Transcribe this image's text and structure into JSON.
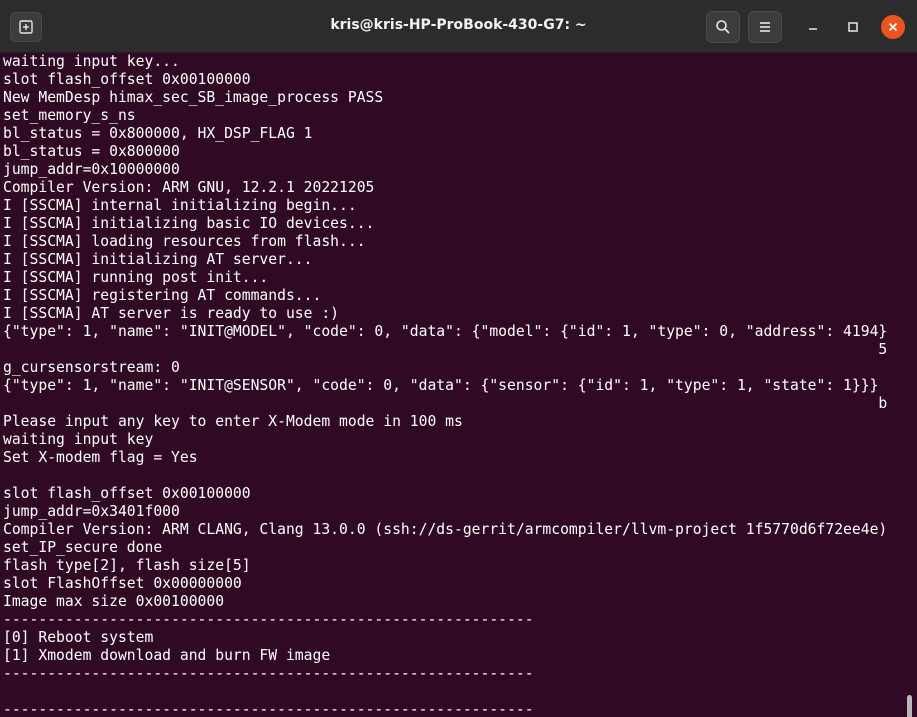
{
  "window": {
    "title": "kris@kris-HP-ProBook-430-G7: ~",
    "new_tab_icon": "new-tab-icon",
    "search_icon": "search-icon",
    "menu_icon": "hamburger-menu-icon",
    "minimize_icon": "minimize-icon",
    "maximize_icon": "maximize-icon",
    "close_icon": "close-icon",
    "close_color": "#e95420",
    "background": "#300a24"
  },
  "terminal": {
    "lines": [
      "waiting input key...",
      "slot flash_offset 0x00100000",
      "New MemDesp himax_sec_SB_image_process PASS",
      "set_memory_s_ns",
      "bl_status = 0x800000, HX_DSP_FLAG 1",
      "bl_status = 0x800000",
      "jump_addr=0x10000000",
      "Compiler Version: ARM GNU, 12.2.1 20221205",
      "I [SSCMA] internal initializing begin...",
      "I [SSCMA] initializing basic IO devices...",
      "I [SSCMA] loading resources from flash...",
      "I [SSCMA] initializing AT server...",
      "I [SSCMA] running post init...",
      "I [SSCMA] registering AT commands...",
      "I [SSCMA] AT server is ready to use :)",
      "{\"type\": 1, \"name\": \"INIT@MODEL\", \"code\": 0, \"data\": {\"model\": {\"id\": 1, \"type\": 0, \"address\": 4194}",
      "                                                                                                   5",
      "g_cursensorstream: 0",
      "{\"type\": 1, \"name\": \"INIT@SENSOR\", \"code\": 0, \"data\": {\"sensor\": {\"id\": 1, \"type\": 1, \"state\": 1}}}",
      "                                                                                                   b",
      "Please input any key to enter X-Modem mode in 100 ms",
      "waiting input key",
      "Set X-modem flag = Yes",
      "",
      "slot flash_offset 0x00100000",
      "jump_addr=0x3401f000",
      "Compiler Version: ARM CLANG, Clang 13.0.0 (ssh://ds-gerrit/armcompiler/llvm-project 1f5770d6f72ee4e)",
      "set_IP_secure done",
      "flash type[2], flash size[5]",
      "slot FlashOffset 0x00000000",
      "Image max size 0x00100000",
      "------------------------------------------------------------",
      "[0] Reboot system",
      "[1] Xmodem download and burn FW image",
      "------------------------------------------------------------",
      "",
      "------------------------------------------------------------"
    ]
  }
}
